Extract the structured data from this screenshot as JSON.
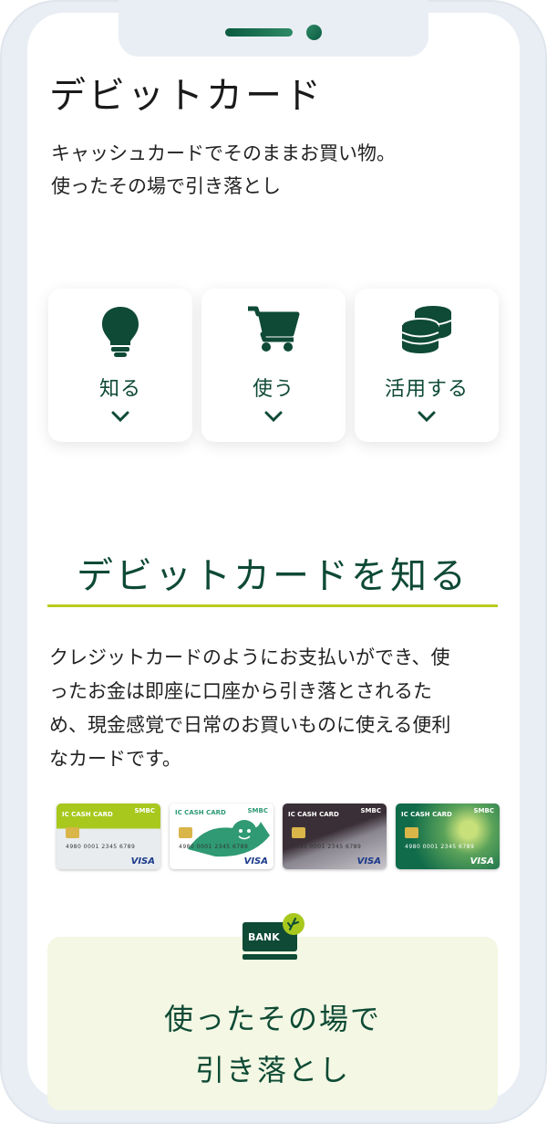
{
  "page": {
    "title": "デビットカード",
    "lead": [
      "キャッシュカードでそのままお買い物。",
      "使ったその場で引き落とし"
    ]
  },
  "menu": [
    {
      "label": "知る",
      "icon": "lightbulb-icon"
    },
    {
      "label": "使う",
      "icon": "shopping-cart-icon"
    },
    {
      "label": "活用する",
      "icon": "coin-stack-icon"
    }
  ],
  "section": {
    "title": "デビットカードを知る",
    "body": [
      "クレジットカードのようにお支払いができ、使",
      "ったお金は即座に口座から引き落とされるた",
      "め、現金感覚で日常のお買いものに使える便利",
      "なカードです。"
    ]
  },
  "cards": [
    {
      "caption": "IC CASH CARD",
      "bank": "SMBC",
      "brand": "VISA",
      "number": "4980 0001 2345 6789",
      "colors": [
        "#a8c81e",
        "#e8ecef"
      ]
    },
    {
      "caption": "IC CASH CARD",
      "bank": "SMBC",
      "brand": "VISA",
      "number": "4980 0001 2345 6789",
      "colors": [
        "#ffffff",
        "#2f9a74"
      ]
    },
    {
      "caption": "IC CASH CARD",
      "bank": "SMBC",
      "brand": "VISA",
      "number": "4980 0001 2345 6789",
      "colors": [
        "#3a2f36",
        "#c9c6cc"
      ]
    },
    {
      "caption": "IC CASH CARD",
      "bank": "SMBC",
      "brand": "VISA",
      "number": "4980 0001 2345 6789",
      "colors": [
        "#0f6b4a",
        "#c8e07a"
      ]
    }
  ],
  "promo": {
    "icon_label": "BANK",
    "lines": [
      "使ったその場で",
      "引き落とし"
    ]
  },
  "colors": {
    "primary": "#0e4a35",
    "accent": "#b9cc1e",
    "promo_bg": "#f3f7e3"
  }
}
